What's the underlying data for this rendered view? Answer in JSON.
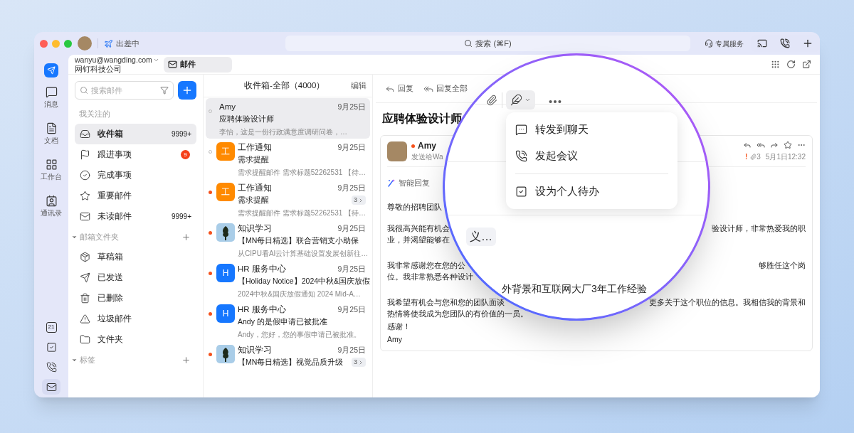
{
  "titlebar": {
    "status": "出差中",
    "search": {
      "placeholder": "搜索 (⌘F)"
    },
    "service": "专属服务"
  },
  "rail": {
    "items": [
      {
        "kind": "chat",
        "label": "消息"
      },
      {
        "kind": "doc",
        "label": "文档"
      },
      {
        "kind": "grid",
        "label": "工作台"
      },
      {
        "kind": "contacts",
        "label": "通讯录"
      }
    ],
    "bottom": [
      {
        "kind": "calendar",
        "text": "21",
        "selected": false
      },
      {
        "kind": "todo",
        "selected": false
      },
      {
        "kind": "phone",
        "selected": false
      },
      {
        "kind": "mail",
        "selected": true
      }
    ]
  },
  "account": {
    "email": "wanyu@wangding.com",
    "org": "网钉科技公司"
  },
  "tabs": [
    {
      "label": "邮件",
      "selected": true
    }
  ],
  "folder_pane": {
    "search": {
      "placeholder": "搜索邮件"
    },
    "sections": [
      {
        "title": "我关注的",
        "items": [
          {
            "kind": "inbox",
            "label": "收件箱",
            "count": "9999+",
            "selected": true
          },
          {
            "kind": "flag",
            "label": "跟进事项",
            "badge": "9",
            "selected": false
          },
          {
            "kind": "done",
            "label": "完成事项",
            "selected": false
          },
          {
            "kind": "star",
            "label": "重要邮件",
            "selected": false
          },
          {
            "kind": "mail",
            "label": "未读邮件",
            "count": "9999+",
            "selected": false
          }
        ]
      },
      {
        "title": "邮箱文件夹",
        "expanded": true,
        "items": [
          {
            "kind": "box",
            "label": "草稿箱",
            "selected": false
          },
          {
            "kind": "send",
            "label": "已发送",
            "selected": false
          },
          {
            "kind": "trash",
            "label": "已删除",
            "selected": false
          },
          {
            "kind": "warning",
            "label": "垃圾邮件",
            "selected": false
          },
          {
            "kind": "folder",
            "label": "文件夹",
            "selected": false
          }
        ]
      },
      {
        "title": "标签",
        "expanded": true
      }
    ]
  },
  "mail_list": {
    "title": "收件箱-全部（4000）",
    "edit": "编辑",
    "items": [
      {
        "unread": false,
        "avatar": {
          "kind": "photo"
        },
        "sender": "Amy",
        "date": "9月25日",
        "subject": "应聘体验设计师",
        "preview": "李怡，这是一份行政满意度调研问卷，…",
        "selected": true
      },
      {
        "unread": false,
        "avatar": {
          "kind": "letter",
          "text": "工",
          "color": "#ff8a00"
        },
        "sender": "工作通知",
        "date": "9月25日",
        "subject": "需求提醒",
        "preview": "需求提醒邮件 需求标题52262531 【待…",
        "selected": false
      },
      {
        "unread": true,
        "avatar": {
          "kind": "letter",
          "text": "工",
          "color": "#ff8a00"
        },
        "sender": "工作通知",
        "date": "9月25日",
        "subject": "需求提醒",
        "count": "3",
        "preview": "需求提醒邮件 需求标题52262531 【待…",
        "selected": false
      },
      {
        "unread": true,
        "avatar": {
          "kind": "image"
        },
        "sender": "知识学习",
        "date": "9月25日",
        "subject": "【MN每日精选】联合营销支小助保",
        "preview": "从CIPU看AI云计算基础设置发展创新往…",
        "selected": false
      },
      {
        "unread": true,
        "avatar": {
          "kind": "letter",
          "text": "H",
          "color": "#1677ff"
        },
        "sender": "HR 服务中心",
        "date": "9月25日",
        "subject": "【Holiday Notice】2024中秋&国庆放假",
        "preview": "2024中秋&国庆放假通知 2024 Mid-A…",
        "selected": false
      },
      {
        "unread": true,
        "avatar": {
          "kind": "letter",
          "text": "H",
          "color": "#1677ff"
        },
        "sender": "HR 服务中心",
        "date": "9月25日",
        "subject": "Andy 的是假申请已被批准",
        "preview": "Andy，您好，您的事假申请已被批准。",
        "selected": false
      },
      {
        "unread": true,
        "avatar": {
          "kind": "image"
        },
        "sender": "知识学习",
        "date": "9月25日",
        "subject": "【MN每日精选】视觉品质升级",
        "count": "3",
        "selected": false
      }
    ]
  },
  "reading": {
    "toolbar": [
      {
        "kind": "reply",
        "label": "回复"
      },
      {
        "kind": "reply-all",
        "label": "回复全部"
      }
    ],
    "subject": "应聘体验设计师",
    "message": {
      "sender": "Amy",
      "unread": true,
      "to": "发送给Wa",
      "priority": "!",
      "attachments": "3",
      "time": "5月1日12:32",
      "smart_reply": "智能回复",
      "greeting": "尊敬的招聘团队",
      "paragraphs": [
        {
          "lines": [
            {
              "left": "我很高兴能有机会",
              "right": "验设计师，非常热爱我的职"
            },
            {
              "left": "业，并渴望能够在"
            }
          ]
        },
        {
          "lines": [
            {
              "left": "我非常感谢您在您的公",
              "right": "够胜任这个岗"
            },
            {
              "left": "位。我非常熟悉各种设计"
            }
          ]
        },
        {
          "lines": [
            {
              "left": "我希望有机会与您和您的团队面谈",
              "right": "更多关于这个职位的信息。我相信我的背景和"
            },
            {
              "left": "热情将使我成为您团队的有价值的一员。"
            }
          ]
        }
      ],
      "closing": "感谢！",
      "signature": "Amy"
    }
  },
  "lens": {
    "menu": [
      {
        "kind": "chat",
        "label": "转发到聊天",
        "separated": false
      },
      {
        "kind": "meeting",
        "label": "发起会议",
        "separated": false
      },
      {
        "kind": "todo",
        "label": "设为个人待办",
        "separated": true
      }
    ],
    "chip": "义…",
    "magnified_text": "外背景和互联网大厂3年工作经验"
  }
}
